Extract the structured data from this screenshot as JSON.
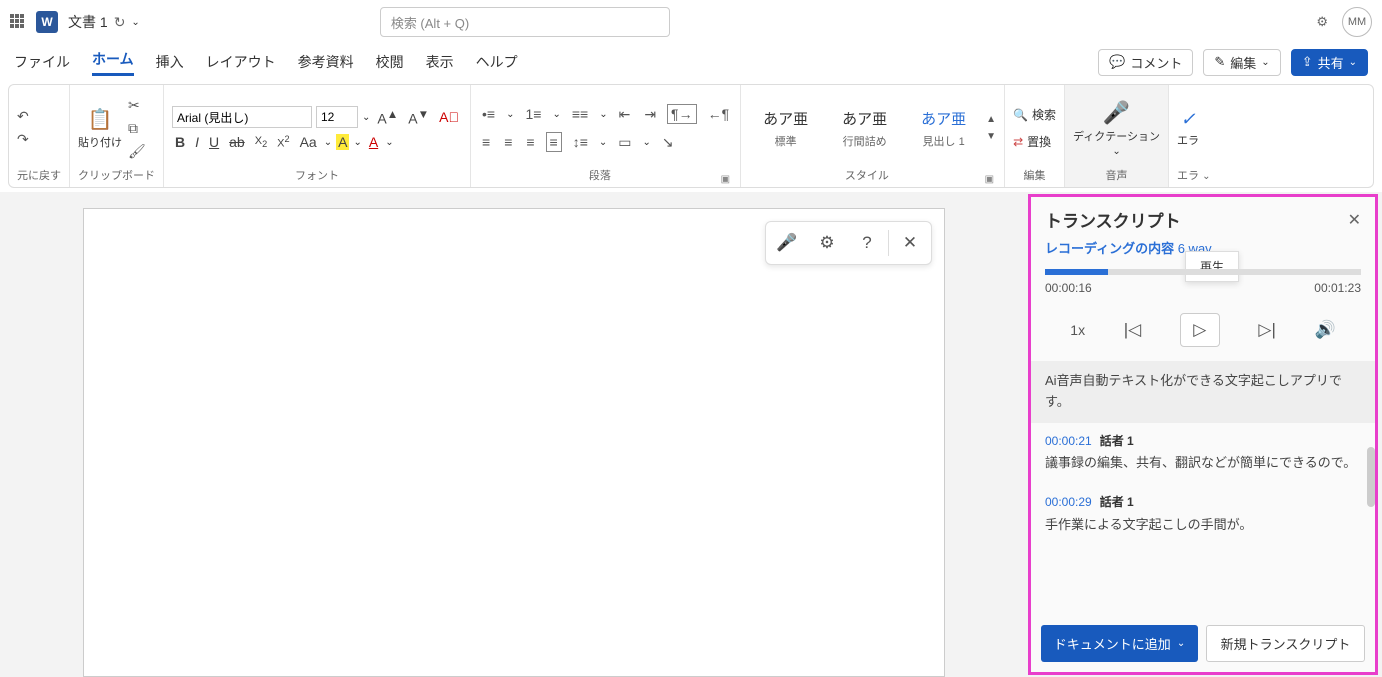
{
  "title": {
    "doc_name": "文書 1",
    "search_placeholder": "検索 (Alt + Q)",
    "avatar": "MM"
  },
  "menu": {
    "tabs": [
      "ファイル",
      "ホーム",
      "挿入",
      "レイアウト",
      "参考資料",
      "校閲",
      "表示",
      "ヘルプ"
    ],
    "active_index": 1,
    "comment": "コメント",
    "edit": "編集",
    "share": "共有"
  },
  "ribbon": {
    "undo_label": "元に戻す",
    "paste": "貼り付け",
    "clipboard_label": "クリップボード",
    "font_name": "Arial (見出し)",
    "font_size": "12",
    "font_label": "フォント",
    "paragraph_label": "段落",
    "styles": [
      {
        "sample": "あア亜",
        "name": "標準"
      },
      {
        "sample": "あア亜",
        "name": "行間詰め"
      },
      {
        "sample": "あア亜",
        "name": "見出し 1"
      }
    ],
    "style_label": "スタイル",
    "find": "検索",
    "replace": "置換",
    "editing_label": "編集",
    "dictation": "ディクテーション",
    "voice_label": "音声",
    "editor": "エラ",
    "editor_label": "エラ"
  },
  "transcript": {
    "title": "トランスクリプト",
    "recording_label": "レコーディングの内容",
    "file_name": "6.wav",
    "tooltip": "再生",
    "time_elapsed": "00:00:16",
    "time_total": "00:01:23",
    "speed": "1x",
    "segments": [
      {
        "ts": "",
        "speaker": "",
        "text": "Ai音声自動テキスト化ができる文字起こしアプリです。",
        "current": true
      },
      {
        "ts": "00:00:21",
        "speaker": "話者 1",
        "text": "議事録の編集、共有、翻訳などが簡単にできるので。",
        "current": false
      },
      {
        "ts": "00:00:29",
        "speaker": "話者 1",
        "text": "手作業による文字起こしの手間が。",
        "current": false
      }
    ],
    "add_to_doc": "ドキュメントに追加",
    "new_transcript": "新規トランスクリプト"
  }
}
